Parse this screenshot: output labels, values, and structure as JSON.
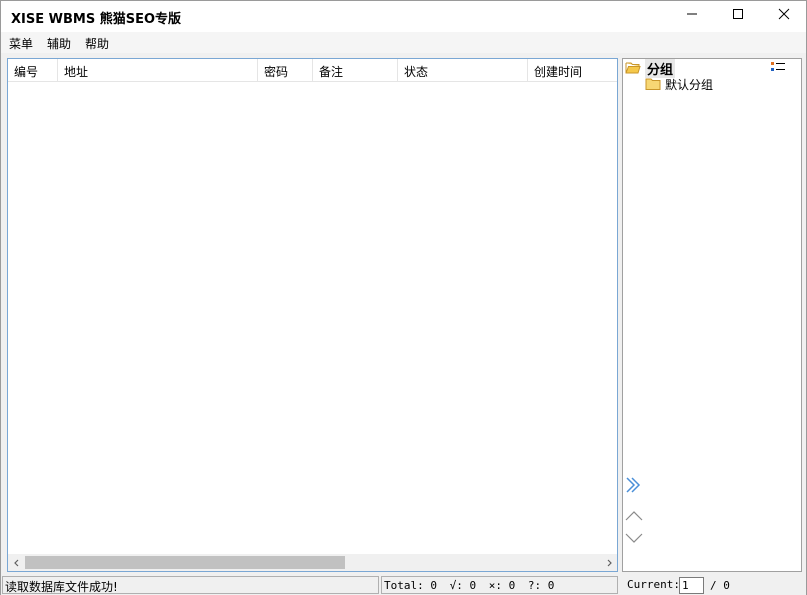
{
  "window": {
    "title": "XISE WBMS 熊猫SEO专版",
    "minimize_icon": "minimize-icon",
    "maximize_icon": "maximize-icon",
    "close_icon": "close-icon"
  },
  "menubar": {
    "items": [
      {
        "label": "菜单"
      },
      {
        "label": "辅助"
      },
      {
        "label": "帮助"
      }
    ]
  },
  "table": {
    "columns": [
      "编号",
      "地址",
      "密码",
      "备注",
      "状态",
      "创建时间"
    ],
    "rows": []
  },
  "tree": {
    "root": {
      "label": "分组",
      "icon": "folder-open-icon"
    },
    "children": [
      {
        "label": "默认分组",
        "icon": "folder-icon"
      }
    ],
    "toolbar_icon": "list-menu-icon"
  },
  "status": {
    "message": "读取数据库文件成功!",
    "total": "Total: 0",
    "ok": "√: 0",
    "fail": "×: 0",
    "unknown": "?: 0",
    "current_label": "Current:",
    "current_page": "1",
    "page_total": "/ 0"
  },
  "colors": {
    "accent": "#4a8fd8",
    "list_border": "#7aa7d4",
    "folder": "#f0c040"
  }
}
